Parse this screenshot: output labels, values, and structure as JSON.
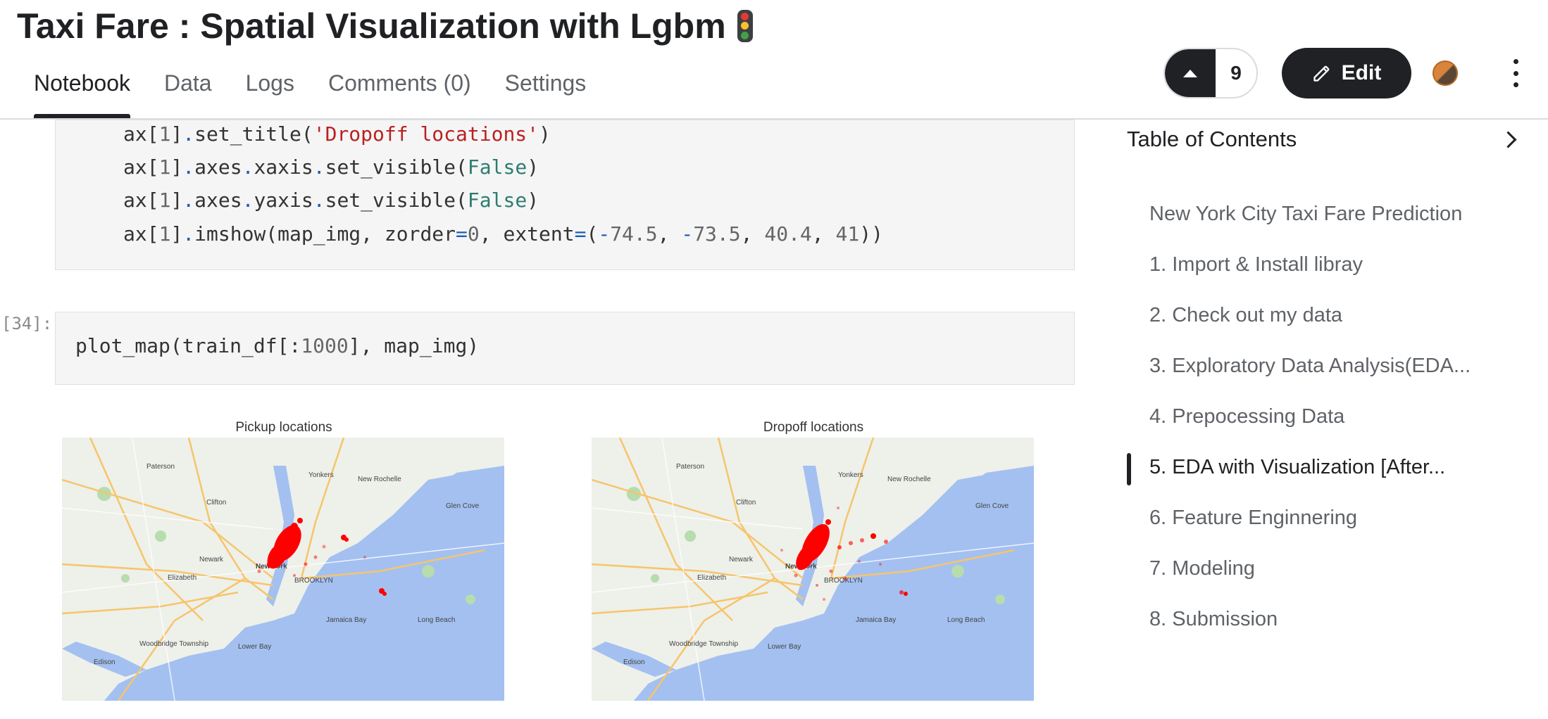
{
  "header": {
    "title": "Taxi Fare : Spatial Visualization with Lgbm",
    "title_icon": "traffic-light-icon",
    "tabs": [
      {
        "label": "Notebook",
        "active": true
      },
      {
        "label": "Data",
        "active": false
      },
      {
        "label": "Logs",
        "active": false
      },
      {
        "label": "Comments (0)",
        "active": false
      },
      {
        "label": "Settings",
        "active": false
      }
    ],
    "vote_count": "9",
    "edit_label": "Edit"
  },
  "cells": {
    "cell_a_lines": [
      "ax[1].set_title('Dropoff locations')",
      "ax[1].axes.xaxis.set_visible(False)",
      "ax[1].axes.yaxis.set_visible(False)",
      "ax[1].imshow(map_img, zorder=0, extent=(-74.5, -73.5, 40.4, 41))"
    ],
    "cell_b_prompt": "[34]:",
    "cell_b_code": "plot_map(train_df[:1000], map_img)"
  },
  "output": {
    "plots": [
      {
        "title": "Pickup locations"
      },
      {
        "title": "Dropoff locations"
      }
    ],
    "map_labels": [
      "Paterson",
      "Yonkers",
      "Clifton",
      "New Rochelle",
      "Newark",
      "New York",
      "Elizabeth",
      "Edison",
      "Woodbridge Township",
      "BROOKLYN",
      "Long Beach",
      "Jamaica Bay",
      "Lower Bay",
      "Glen Cove"
    ]
  },
  "toc": {
    "title": "Table of Contents",
    "items": [
      {
        "label": "New York City Taxi Fare Prediction",
        "active": false
      },
      {
        "label": "1. Import & Install libray",
        "active": false
      },
      {
        "label": "2. Check out my data",
        "active": false
      },
      {
        "label": "3. Exploratory Data Analysis(EDA...",
        "active": false
      },
      {
        "label": "4. Prepocessing Data",
        "active": false
      },
      {
        "label": "5. EDA with Visualization [After...",
        "active": true
      },
      {
        "label": "6. Feature Enginnering",
        "active": false
      },
      {
        "label": "7. Modeling",
        "active": false
      },
      {
        "label": "8. Submission",
        "active": false
      }
    ]
  },
  "colors": {
    "accent": "#202124",
    "code_string": "#ba2121",
    "code_keyword": "#2d7d6f",
    "map_water": "#a3c0f0",
    "map_land": "#eef0ea",
    "points": "#ff0000"
  }
}
